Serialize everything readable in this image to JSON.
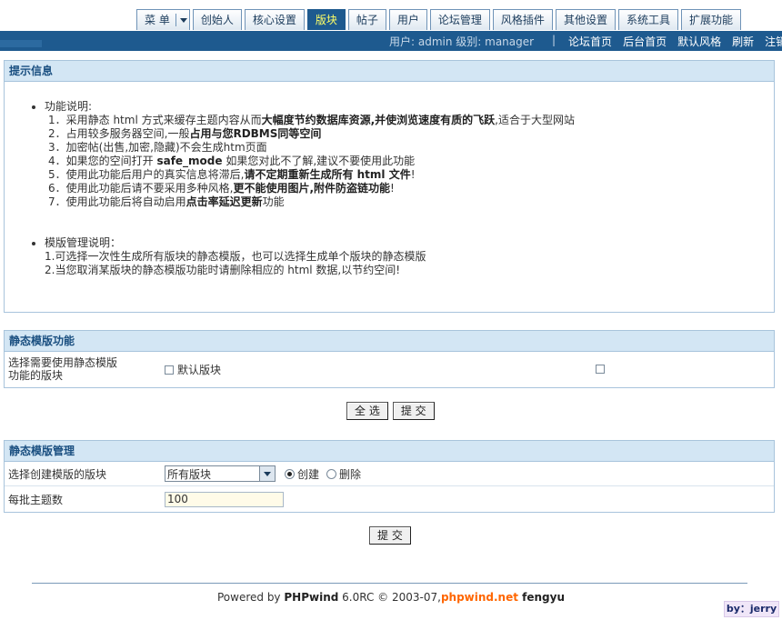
{
  "nav": {
    "menu_label": "菜 单",
    "tabs": [
      "创始人",
      "核心设置",
      "版块",
      "帖子",
      "用户",
      "论坛管理",
      "风格插件",
      "其他设置",
      "系统工具",
      "扩展功能"
    ],
    "active_tab": "版块"
  },
  "userbar": {
    "info": "用户: admin 级别: manager",
    "separator": "|",
    "links": [
      "论坛首页",
      "后台首页",
      "默认风格",
      "刷新",
      "注销"
    ]
  },
  "tips": {
    "title": "提示信息",
    "section1_label": "功能说明:",
    "items": [
      {
        "pre": "1．采用静态 html 方式来缓存主题内容从而",
        "bold": "大幅度节约数据库资源,并使浏览速度有质的飞跃",
        "post": ",适合于大型网站"
      },
      {
        "pre": "2．占用较多服务器空间,一般",
        "bold": "占用与您RDBMS同等空间",
        "post": ""
      },
      {
        "pre": "3．加密帖(出售,加密,隐藏)不会生成htm页面",
        "bold": "",
        "post": ""
      },
      {
        "pre": "4．如果您的空间打开 ",
        "bold": "safe_mode",
        "post": " 如果您对此不了解,建议不要使用此功能"
      },
      {
        "pre": "5．使用此功能后用户的真实信息将滞后,",
        "bold": "请不定期重新生成所有 html 文件",
        "post": "!"
      },
      {
        "pre": "6．使用此功能后请不要采用多种风格,",
        "bold": "更不能使用图片,附件防盗链功能",
        "post": "!"
      },
      {
        "pre": "7．使用此功能后将自动启用",
        "bold": "点击率延迟更新",
        "post": "功能"
      }
    ],
    "section2_label": "模版管理说明：",
    "items2": [
      "1.可选择一次性生成所有版块的静态模版，也可以选择生成单个版块的静态模版",
      "2.当您取消某版块的静态模版功能时请删除相应的 html 数据,以节约空间!"
    ]
  },
  "static_func": {
    "title": "静态模版功能",
    "row_label": "选择需要使用静态模版功能的版块",
    "checkbox_label": "默认版块",
    "select_all_btn": "全 选",
    "submit_btn": "提 交"
  },
  "static_manage": {
    "title": "静态模版管理",
    "row1_label": "选择创建模版的版块",
    "select_value": "所有版块",
    "radio_create": "创建",
    "radio_delete": "删除",
    "row2_label": "每批主题数",
    "batch_value": "100",
    "submit_btn": "提 交"
  },
  "footer": {
    "powered": "Powered by ",
    "brand": "PHPwind",
    "version": " 6.0RC © 2003-07,",
    "site": "phpwind.net",
    "author": " fengyu",
    "byline": "by：jerry"
  }
}
